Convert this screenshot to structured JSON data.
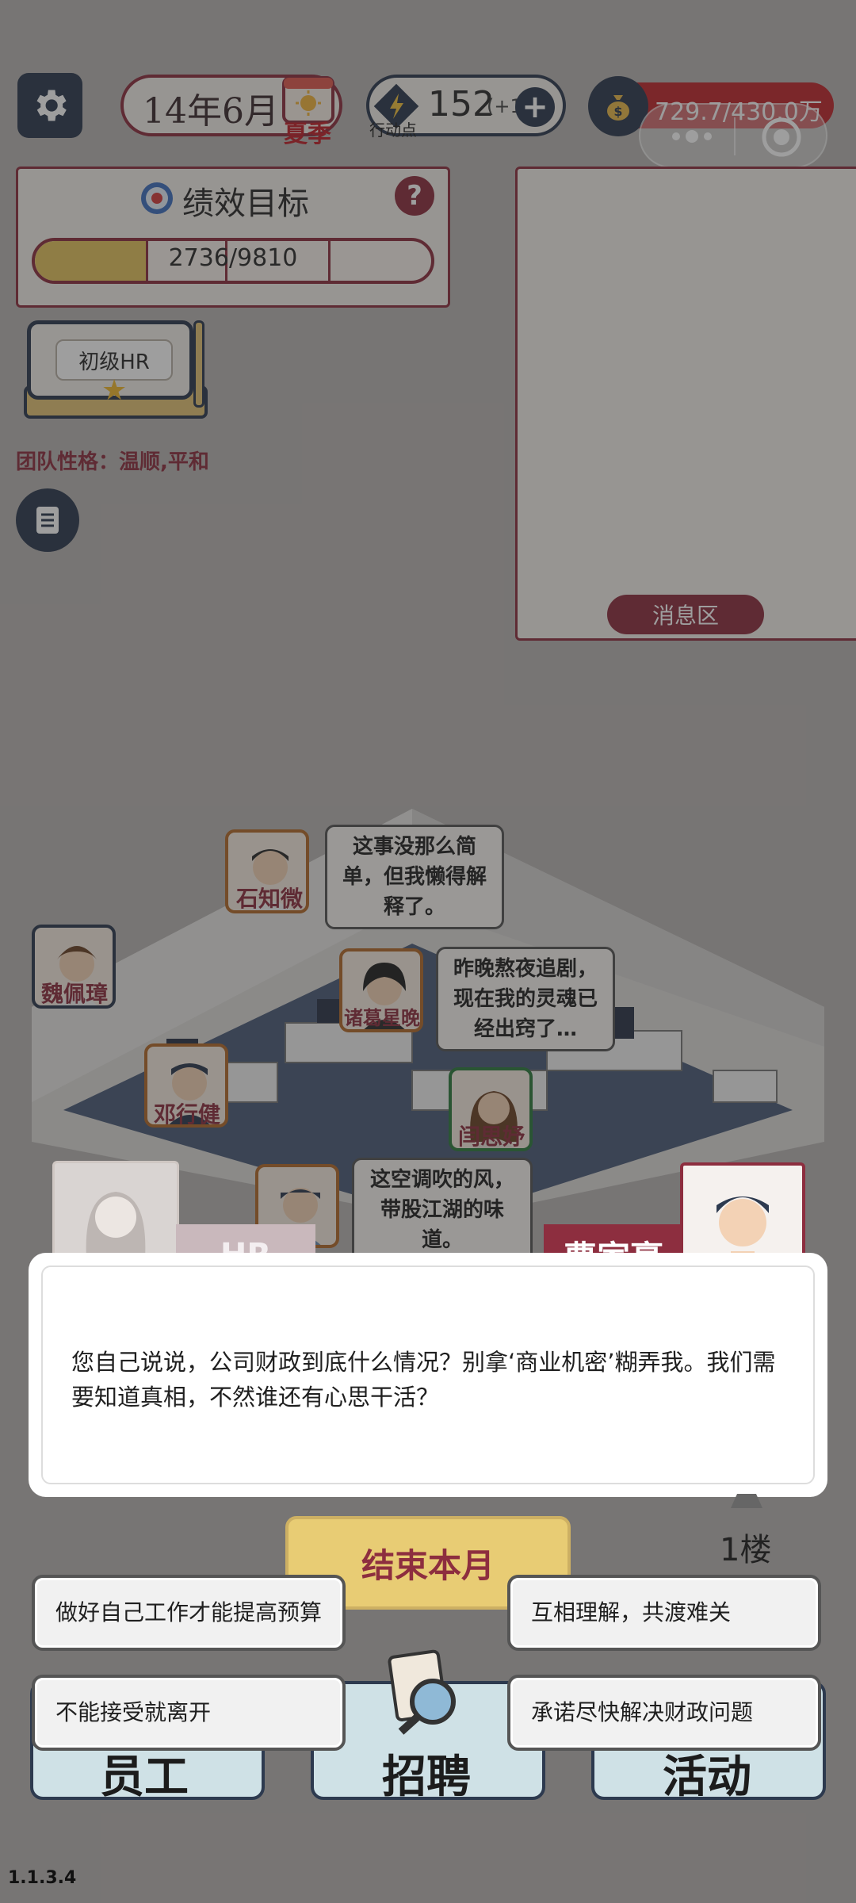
{
  "top_bar": {
    "date": "14年6月",
    "season": "夏季",
    "action_points": "152",
    "action_points_bonus": "(+1",
    "action_points_label": "行动点",
    "money": "729.7/430.0万"
  },
  "performance": {
    "title": "绩效目标",
    "help": "?",
    "progress_text": "2736/9810",
    "progress_fraction": 0.279
  },
  "rank": {
    "label": "初级HR"
  },
  "team_personality": "团队性格：温顺,平和",
  "message_area": {
    "label": "消息区"
  },
  "office": {
    "employees": [
      {
        "name": "石知微",
        "bubble": "这事没那么简单，但我懒得解释了。"
      },
      {
        "name": "魏佩璋"
      },
      {
        "name": "诸葛星晚",
        "bubble": "昨晚熬夜追剧，现在我的灵魂已经出窍了…"
      },
      {
        "name": "邓行健"
      },
      {
        "name": "闫思妤"
      },
      {
        "name": "曹家豪",
        "bubble": "这空调吹的风，带股江湖的味道。"
      }
    ]
  },
  "dialog": {
    "left_speaker": "HR",
    "right_speaker": "曹家豪",
    "text": "您自己说说，公司财政到底什么情况？别拿‘商业机密’糊弄我。我们需要知道真相，不然谁还有心思干活？"
  },
  "bottom": {
    "end_month": "结束本月",
    "floor": "1楼",
    "tabs": [
      "员工",
      "招聘",
      "活动"
    ],
    "choices": [
      "做好自己工作才能提高预算",
      "互相理解，共渡难关",
      "不能接受就离开",
      "承诺尽快解决财政问题"
    ]
  },
  "version": "1.1.3.4",
  "colors": {
    "accent": "#8d2e3f",
    "navy": "#2d3a4f",
    "gold": "#e3c35d"
  }
}
